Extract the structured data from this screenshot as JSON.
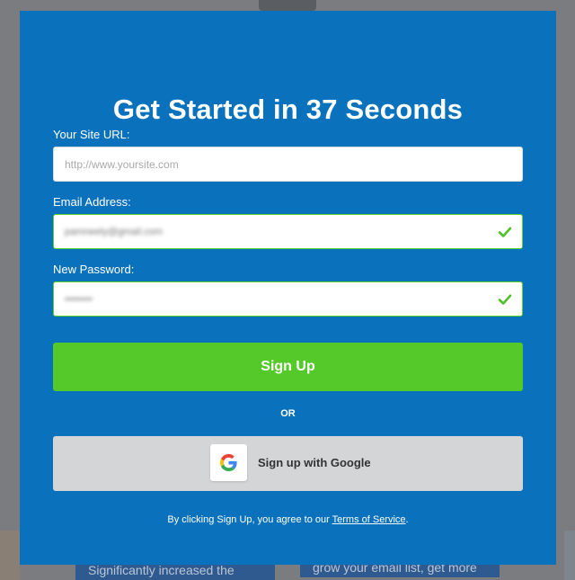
{
  "background": {
    "card_left_text": "Significantly increased the",
    "card_right_text": "grow your email list, get more"
  },
  "modal": {
    "title": "Get Started in 37 Seconds",
    "site_url": {
      "label": "Your Site URL:",
      "placeholder": "http://www.yoursite.com",
      "value": ""
    },
    "email": {
      "label": "Email Address:",
      "value": "pamneely@gmail.com",
      "valid": true
    },
    "password": {
      "label": "New Password:",
      "value": "••••••••",
      "valid": true
    },
    "signup_label": "Sign Up",
    "or_label": "OR",
    "google_label": "Sign up with Google",
    "terms_prefix": "By clicking Sign Up, you agree to our ",
    "terms_link": "Terms of Service",
    "terms_suffix": "."
  },
  "colors": {
    "modal_bg": "#0a72bc",
    "signup_green": "#56c92a",
    "valid_border": "#5bd12a",
    "google_btn_bg": "#d4d5d7"
  },
  "icons": {
    "email_status": "check-icon",
    "password_status": "check-icon",
    "google": "google-logo-icon"
  }
}
